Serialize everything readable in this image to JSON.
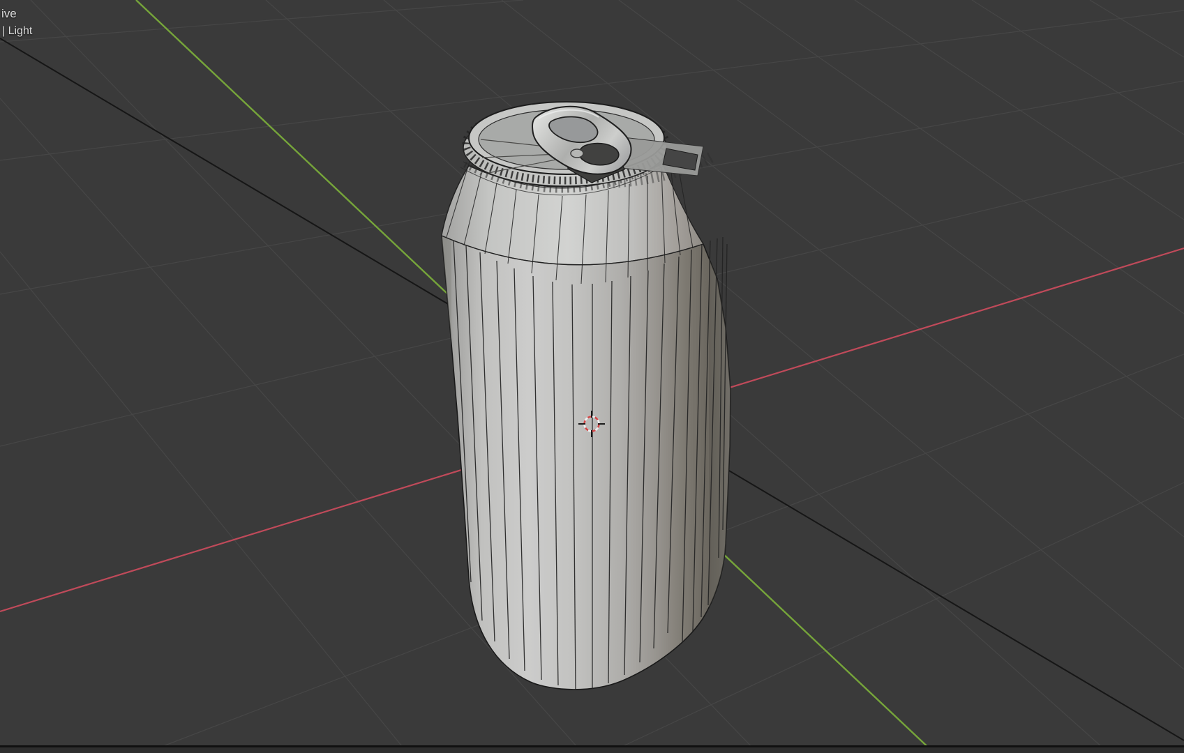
{
  "viewport": {
    "overlay_top_left": {
      "line1": "ive",
      "line2": "| Light"
    }
  },
  "colors": {
    "background": "#3a3a3a",
    "grid_line": "#484848",
    "axis_x": "#c04a5a",
    "axis_y": "#76a53a",
    "guide_line": "#161616",
    "wireframe": "#232323",
    "cursor_red": "#d24848",
    "cursor_white": "#efefef",
    "statusbar_divider": "#101010",
    "statusbar_strip": "#2e2e2e"
  }
}
